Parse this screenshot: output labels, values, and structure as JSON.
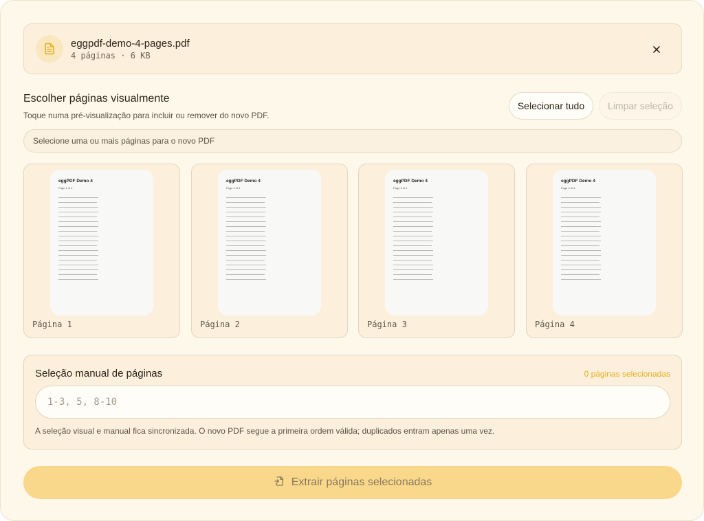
{
  "file": {
    "name": "eggpdf-demo-4-pages.pdf",
    "meta": "4 páginas · 6 KB",
    "icon": "file-text-icon"
  },
  "visual": {
    "title": "Escolher páginas visualmente",
    "subtitle": "Toque numa pré-visualização para incluir ou remover do novo PDF.",
    "select_all_label": "Selecionar tudo",
    "clear_label": "Limpar seleção",
    "status": "Selecione uma ou mais páginas para o novo PDF"
  },
  "pages": [
    {
      "label": "Página 1",
      "thumb_title": "eggPDF Demo 4",
      "thumb_sub": "Page 1 of 4"
    },
    {
      "label": "Página 2",
      "thumb_title": "eggPDF Demo 4",
      "thumb_sub": "Page 2 of 4"
    },
    {
      "label": "Página 3",
      "thumb_title": "eggPDF Demo 4",
      "thumb_sub": "Page 3 of 4"
    },
    {
      "label": "Página 4",
      "thumb_title": "eggPDF Demo 4",
      "thumb_sub": "Page 4 of 4"
    }
  ],
  "manual": {
    "title": "Seleção manual de páginas",
    "count": "0 páginas selecionadas",
    "placeholder": "1-3, 5, 8-10",
    "value": "",
    "note": "A seleção visual e manual fica sincronizada. O novo PDF segue a primeira ordem válida; duplicados entram apenas uma vez."
  },
  "extract": {
    "label": "Extrair páginas selecionadas",
    "icon": "extract-icon"
  },
  "colors": {
    "accent": "#f9d88b",
    "count_text": "#e6ae1e",
    "background": "#fef8ea"
  }
}
